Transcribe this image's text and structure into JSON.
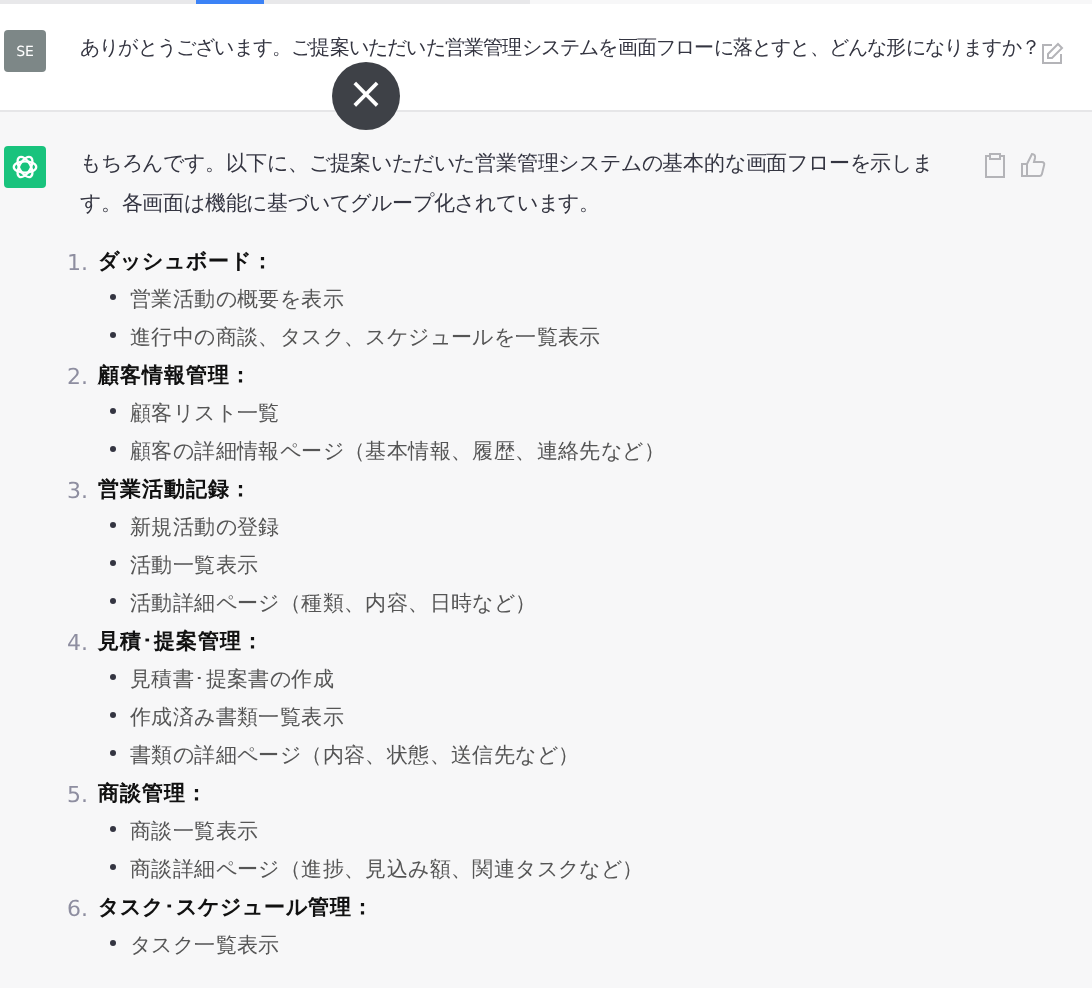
{
  "user_message": {
    "avatar": "SE",
    "text": "ありがとうございます。ご提案いただいた営業管理システムを画面フローに落とすと、どんな形になりますか？"
  },
  "close_button": {
    "label": "×"
  },
  "assistant_message": {
    "intro": "もちろんです。以下に、ご提案いただいた営業管理システムの基本的な画面フローを示します。各画面は機能に基づいてグループ化されています。",
    "sections": [
      {
        "number": "1.",
        "title": "ダッシュボード：",
        "items": [
          "営業活動の概要を表示",
          "進行中の商談、タスク、スケジュールを一覧表示"
        ]
      },
      {
        "number": "2.",
        "title": "顧客情報管理：",
        "items": [
          "顧客リスト一覧",
          "顧客の詳細情報ページ（基本情報、履歴、連絡先など）"
        ]
      },
      {
        "number": "3.",
        "title": "営業活動記録：",
        "items": [
          "新規活動の登録",
          "活動一覧表示",
          "活動詳細ページ（種類、内容、日時など）"
        ]
      },
      {
        "number": "4.",
        "title": "見積･提案管理：",
        "items": [
          "見積書･提案書の作成",
          "作成済み書類一覧表示",
          "書類の詳細ページ（内容、状態、送信先など）"
        ]
      },
      {
        "number": "5.",
        "title": "商談管理：",
        "items": [
          "商談一覧表示",
          "商談詳細ページ（進捗、見込み額、関連タスクなど）"
        ]
      },
      {
        "number": "6.",
        "title": "タスク･スケジュール管理：",
        "items": [
          "タスク一覧表示"
        ]
      }
    ]
  }
}
